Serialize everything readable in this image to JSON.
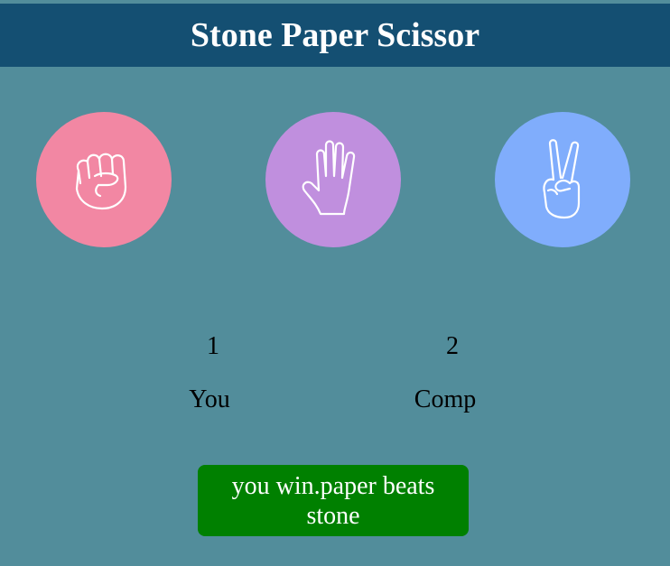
{
  "header": {
    "title": "Stone Paper Scissor"
  },
  "choices": [
    {
      "id": "stone",
      "icon": "fist-icon",
      "color": "#f287a3"
    },
    {
      "id": "paper",
      "icon": "open-hand-icon",
      "color": "#c08fde"
    },
    {
      "id": "scissor",
      "icon": "peace-hand-icon",
      "color": "#80adfc"
    }
  ],
  "scoreboard": {
    "user": {
      "score": "1",
      "label": "You"
    },
    "comp": {
      "score": "2",
      "label": "Comp"
    }
  },
  "message": {
    "text": "you win.paper beats stone",
    "color": "#008000"
  }
}
